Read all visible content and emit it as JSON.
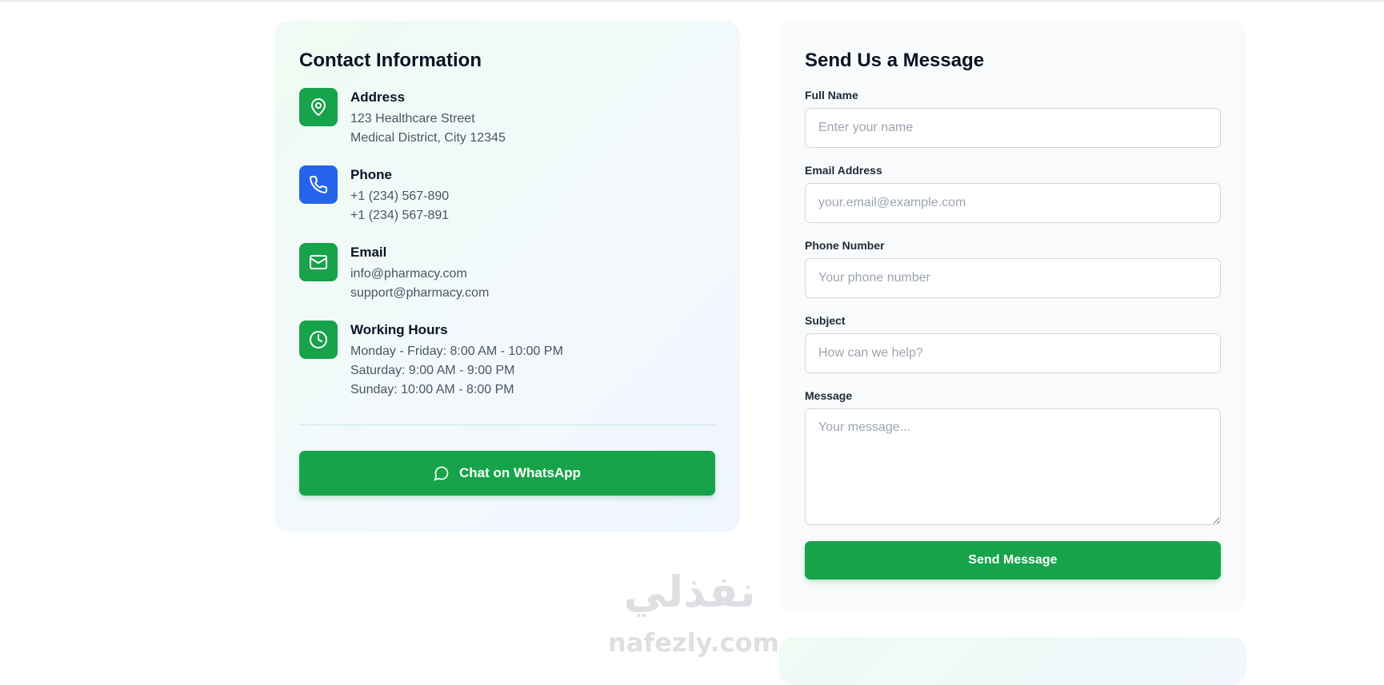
{
  "contact": {
    "title": "Contact Information",
    "items": [
      {
        "icon": "map-pin-icon",
        "title": "Address",
        "lines": [
          "123 Healthcare Street",
          "Medical District, City 12345"
        ]
      },
      {
        "icon": "phone-icon",
        "title": "Phone",
        "lines": [
          "+1 (234) 567-890",
          "+1 (234) 567-891"
        ]
      },
      {
        "icon": "mail-icon",
        "title": "Email",
        "lines": [
          "info@pharmacy.com",
          "support@pharmacy.com"
        ]
      },
      {
        "icon": "clock-icon",
        "title": "Working Hours",
        "lines": [
          "Monday - Friday: 8:00 AM - 10:00 PM",
          "Saturday: 9:00 AM - 9:00 PM",
          "Sunday: 10:00 AM - 8:00 PM"
        ]
      }
    ],
    "whatsapp_label": "Chat on WhatsApp",
    "whatsapp_icon": "message-circle-icon"
  },
  "form": {
    "title": "Send Us a Message",
    "full_name": {
      "label": "Full Name",
      "placeholder": "Enter your name",
      "value": ""
    },
    "email": {
      "label": "Email Address",
      "placeholder": "your.email@example.com",
      "value": ""
    },
    "phone": {
      "label": "Phone Number",
      "placeholder": "Your phone number",
      "value": ""
    },
    "subject": {
      "label": "Subject",
      "placeholder": "How can we help?",
      "value": ""
    },
    "message": {
      "label": "Message",
      "placeholder": "Your message...",
      "value": ""
    },
    "submit_label": "Send Message"
  },
  "watermark": {
    "arabic": "نفذلي",
    "latin": "nafezly.com"
  },
  "colors": {
    "primary_green": "#16a34a",
    "phone_blue": "#2563eb",
    "heading": "#0b1324",
    "body_text": "#4b5563"
  }
}
